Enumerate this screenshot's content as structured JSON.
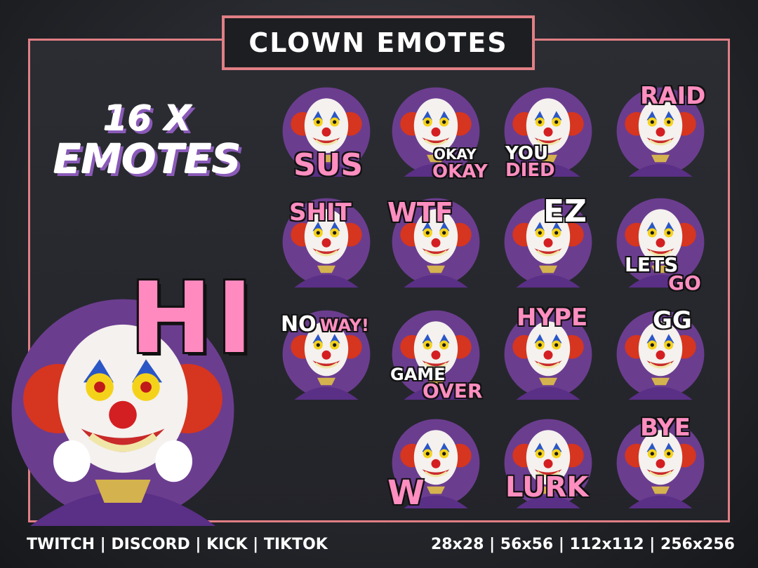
{
  "title": "CLOWN EMOTES",
  "count": {
    "line1": "16 X",
    "line2": "EMOTES"
  },
  "featured": {
    "label": "HI"
  },
  "emotes": [
    {
      "label": "SUS"
    },
    {
      "label_top": "OKAY",
      "label_bottom": "OKAY"
    },
    {
      "label_top": "YOU",
      "label_bottom": "DIED"
    },
    {
      "label": "RAID"
    },
    {
      "label": "SHIT"
    },
    {
      "label": "WTF"
    },
    {
      "label": "EZ"
    },
    {
      "label_top": "LETS",
      "label_bottom": "GO"
    },
    {
      "label_a": "NO",
      "label_b": "WAY!"
    },
    {
      "label_top": "GAME",
      "label_bottom": "OVER"
    },
    {
      "label": "HYPE"
    },
    {
      "label": "GG"
    },
    {
      "label": "W"
    },
    {
      "label": "LURK"
    },
    {
      "label": "BYE"
    }
  ],
  "footer": {
    "platforms": "TWITCH | DISCORD | KICK | TIKTOK",
    "sizes": "28x28  | 56x56 | 112x112 | 256x256"
  },
  "colors": {
    "accent": "#e07f85",
    "circle": "#6b3d8f",
    "hair": "#d6351f",
    "label": "#ff8ec0"
  }
}
